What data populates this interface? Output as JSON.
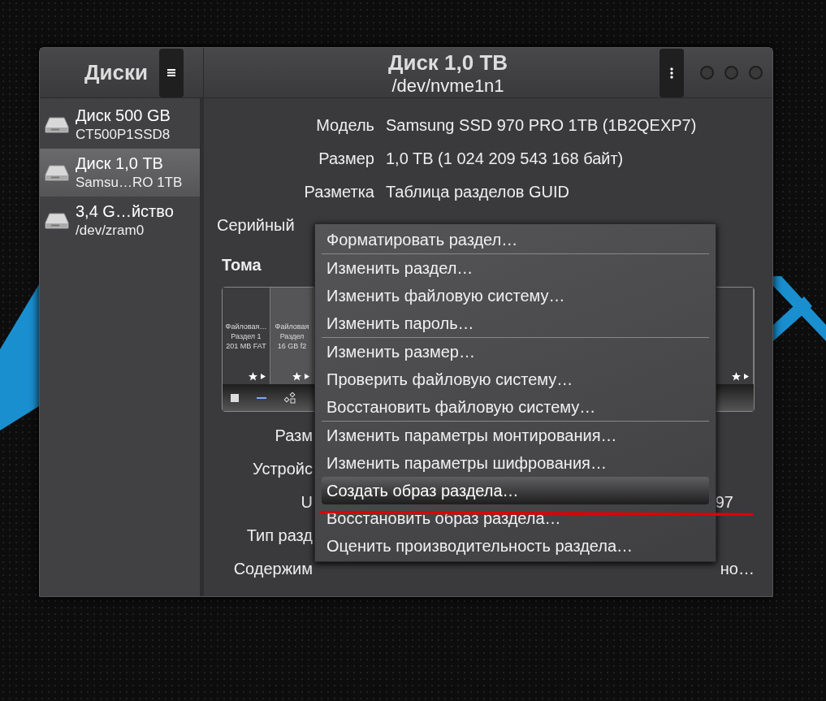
{
  "sidebar": {
    "title": "Диски",
    "items": [
      {
        "name": "Диск 500 GB",
        "subtitle": "CT500P1SSD8",
        "selected": false
      },
      {
        "name": "Диск 1,0 TB",
        "subtitle": "Samsu…RO 1TB",
        "selected": true
      },
      {
        "name": "3,4 G…йство",
        "subtitle": "/dev/zram0",
        "selected": false
      }
    ]
  },
  "header": {
    "title": "Диск 1,0 TB",
    "subtitle": "/dev/nvme1n1"
  },
  "drive_details": [
    {
      "label": "Модель",
      "value": "Samsung SSD 970 PRO 1TB (1B2QEXP7)"
    },
    {
      "label": "Размер",
      "value": "1,0 TB (1 024 209 543 168 байт)"
    },
    {
      "label": "Разметка",
      "value": "Таблица разделов GUID"
    },
    {
      "label": "Серийный"
    }
  ],
  "volumes": {
    "title": "Тома",
    "partitions": [
      {
        "lines": [
          "Файловая…",
          "Раздел 1",
          "201 MB FAT"
        ],
        "selected": false
      },
      {
        "lines": [
          "Файловая",
          "Раздел",
          "16 GB f2"
        ],
        "selected": true
      },
      {
        "selected": false
      }
    ]
  },
  "volume_details": [
    {
      "label": "Разм"
    },
    {
      "label": "Устройс"
    },
    {
      "label": "U",
      "value": "97"
    },
    {
      "label": "Тип разд"
    },
    {
      "label": "Содержим",
      "value": "но…"
    }
  ],
  "context_menu": [
    {
      "label": "Форматировать раздел…",
      "selected": false,
      "separator_after": true
    },
    {
      "label": "Изменить раздел…",
      "selected": false,
      "separator_after": false
    },
    {
      "label": "Изменить файловую систему…",
      "selected": false,
      "separator_after": false
    },
    {
      "label": "Изменить пароль…",
      "selected": false,
      "separator_after": true
    },
    {
      "label": "Изменить размер…",
      "selected": false,
      "separator_after": false
    },
    {
      "label": "Проверить файловую систему…",
      "selected": false,
      "separator_after": false
    },
    {
      "label": "Восстановить файловую систему…",
      "selected": false,
      "separator_after": true
    },
    {
      "label": "Изменить параметры монтирования…",
      "selected": false,
      "separator_after": false
    },
    {
      "label": "Изменить параметры шифрования…",
      "selected": false,
      "separator_after": false
    },
    {
      "label": "Создать образ раздела…",
      "selected": true,
      "separator_after": false
    },
    {
      "label": "Восстановить образ раздела…",
      "selected": false,
      "separator_after": false
    },
    {
      "label": "Оценить производительность раздела…",
      "selected": false,
      "separator_after": false
    }
  ]
}
